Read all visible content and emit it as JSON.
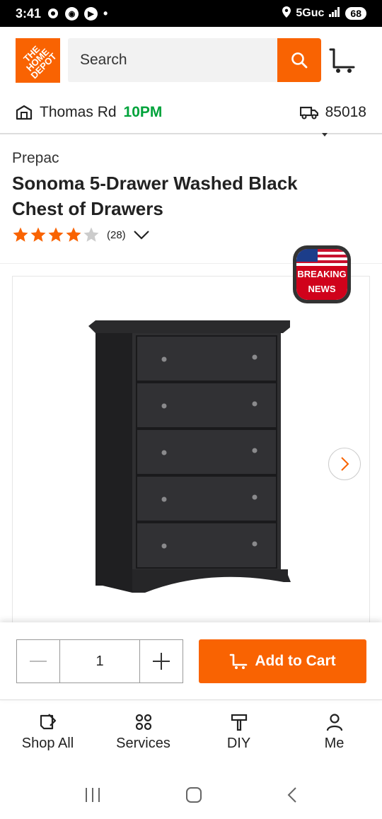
{
  "status_bar": {
    "time": "3:41",
    "network": "5Guc",
    "battery": "68"
  },
  "header": {
    "logo_text": "THE HOME DEPOT",
    "search_placeholder": "Search"
  },
  "store": {
    "name": "Thomas Rd",
    "hours": "10PM",
    "zip": "85018"
  },
  "product": {
    "brand": "Prepac",
    "title": "Sonoma 5-Drawer Washed Black Chest of Drawers",
    "rating": 4,
    "rating_max": 5,
    "review_count": "(28)"
  },
  "badge": {
    "line1": "BREAKING",
    "line2": "NEWS"
  },
  "cart": {
    "quantity": "1",
    "add_label": "Add to Cart"
  },
  "bottom_nav": {
    "items": [
      {
        "label": "Shop All",
        "icon": "shop-all-icon"
      },
      {
        "label": "Services",
        "icon": "services-icon"
      },
      {
        "label": "DIY",
        "icon": "diy-icon"
      },
      {
        "label": "Me",
        "icon": "user-icon"
      }
    ]
  },
  "colors": {
    "brand_orange": "#f96302",
    "hours_green": "#00a33b",
    "star_filled": "#f96302",
    "star_empty": "#cccccc"
  }
}
